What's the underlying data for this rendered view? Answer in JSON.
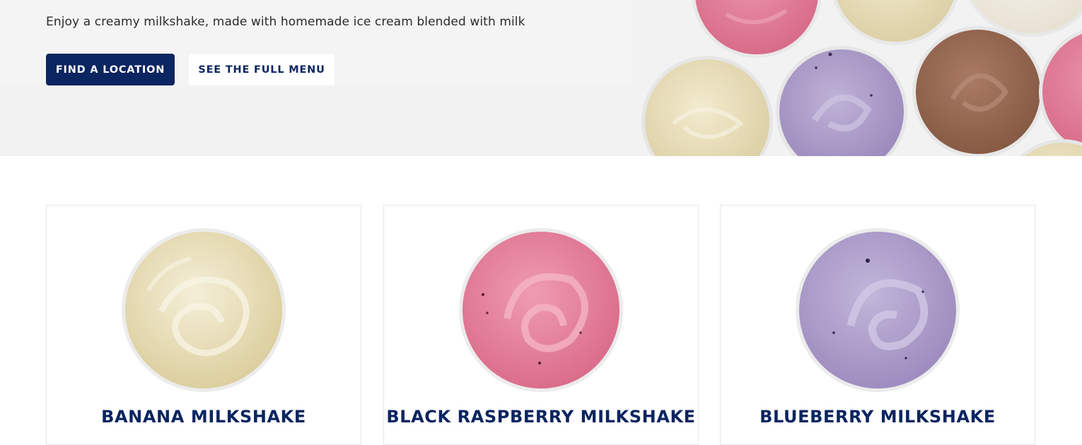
{
  "hero": {
    "description": "Enjoy a creamy milkshake, made with homemade ice cream blended with milk",
    "primary_button": "FIND A LOCATION",
    "secondary_button": "SEE THE FULL MENU"
  },
  "products": [
    {
      "name": "BANANA MILKSHAKE",
      "flavor": "banana"
    },
    {
      "name": "BLACK RASPBERRY MILKSHAKE",
      "flavor": "black-raspberry"
    },
    {
      "name": "BLUEBERRY MILKSHAKE",
      "flavor": "blueberry"
    }
  ],
  "colors": {
    "brand_navy": "#0b2560",
    "hero_background": "#f2f2f2",
    "banana": "#ece2bf",
    "black_raspberry": "#e57d99",
    "blueberry": "#b1a1c8",
    "chocolate": "#96674f",
    "vanilla": "#f3efe5"
  }
}
